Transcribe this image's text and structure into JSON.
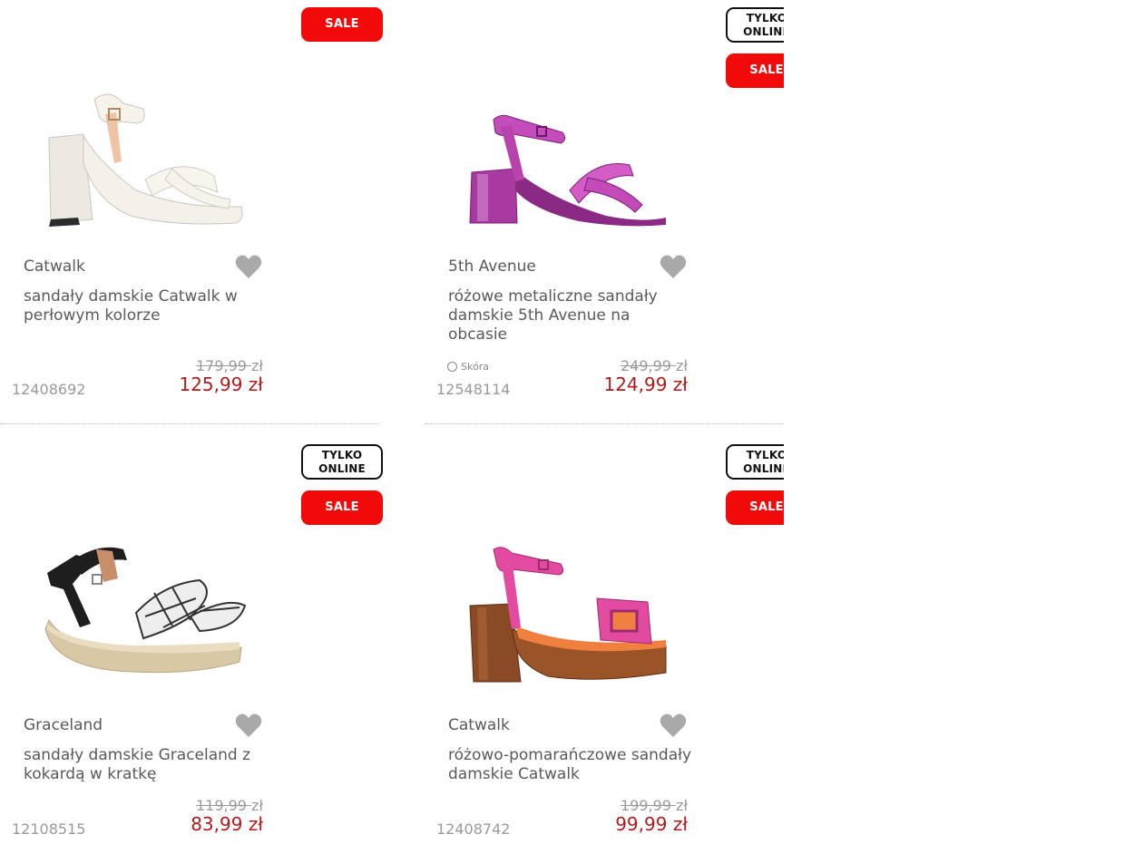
{
  "badges": {
    "sale": "SALE",
    "online": "TYLKO ONLINE",
    "online_line1": "TYLKO",
    "online_line2": "ONLINE"
  },
  "currency": "zł",
  "products": [
    {
      "brand": "Catwalk",
      "name": "sandały damskie Catwalk w perłowym kolorze",
      "sku": "12408692",
      "old_price": "179,99",
      "new_price": "125,99 zł",
      "badges": [
        "SALE"
      ],
      "image": "cream-block-heel-sandal",
      "favorite_icon": "heart-icon"
    },
    {
      "brand": "5th Avenue",
      "name": "różowe metaliczne sandały damskie 5th Avenue na obcasie",
      "sku": "12548114",
      "old_price": "249,99",
      "new_price": "124,99 zł",
      "material": "Skóra",
      "badges": [
        "TYLKO ONLINE",
        "SALE"
      ],
      "image": "pink-metallic-heel-sandal",
      "favorite_icon": "heart-icon"
    },
    {
      "brand": "Graceland",
      "name": "sandały damskie Graceland z kokardą w kratkę",
      "sku": "12108515",
      "old_price": "119,99",
      "new_price": "83,99 zł",
      "badges": [
        "TYLKO ONLINE",
        "SALE"
      ],
      "image": "checkered-bow-espadrille-sandal",
      "favorite_icon": "heart-icon"
    },
    {
      "brand": "Catwalk",
      "name": "różowo-pomarańczowe sandały damskie Catwalk",
      "sku": "12408742",
      "old_price": "199,99",
      "new_price": "99,99 zł",
      "badges": [
        "TYLKO ONLINE",
        "SALE"
      ],
      "image": "pink-orange-platform-sandal",
      "favorite_icon": "heart-icon"
    }
  ],
  "colors": {
    "sale": "#f20a0a",
    "price": "#b01b1b",
    "text": "#5a5a5a",
    "muted": "#9a9a9a",
    "heart": "#a9a9a9"
  }
}
